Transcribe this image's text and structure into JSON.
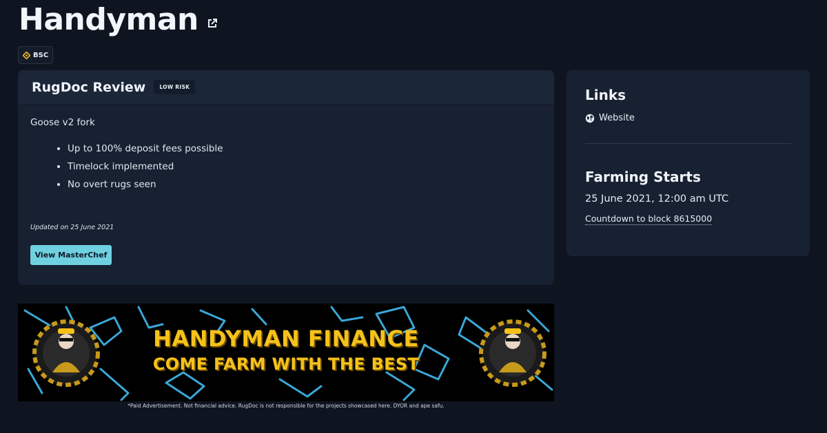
{
  "project": {
    "title": "Handyman",
    "chain": "BSC"
  },
  "review": {
    "title": "RugDoc Review",
    "risk": "LOW RISK",
    "summary": "Goose v2 fork",
    "points": [
      "Up to 100% deposit fees possible",
      "Timelock implemented",
      "No overt rugs seen"
    ],
    "updated": "Updated on 25 June 2021",
    "button_label": "View MasterChef"
  },
  "links": {
    "heading": "Links",
    "website_label": "Website"
  },
  "farming": {
    "heading": "Farming Starts",
    "date": "25 June 2021, 12:00 am UTC",
    "countdown": "Countdown to block 8615000"
  },
  "banner": {
    "line1": "HANDYMAN FINANCE",
    "line2": "COME FARM WITH THE BEST",
    "logo_text": "HANDYMAN FINANCE",
    "disclaimer": "*Paid Advertisement. Not financial advice. RugDoc is not responsible for the projects showcased here. DYOR and ape safu."
  },
  "colors": {
    "background": "#0f1520",
    "card": "#172131",
    "accent_button": "#6fd0e0",
    "banner_text": "#f5c21a",
    "banner_tools": "#3aa8d8"
  }
}
